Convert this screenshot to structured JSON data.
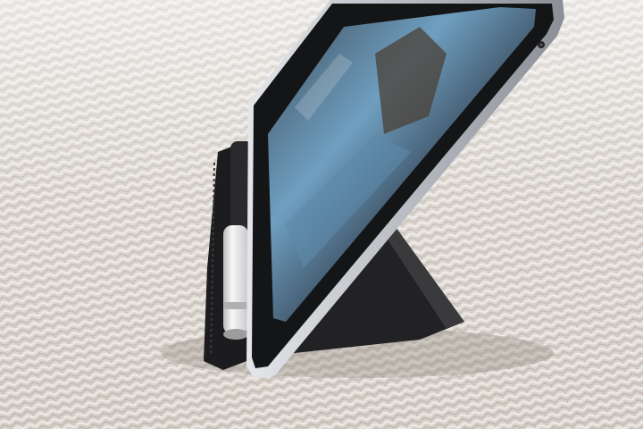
{
  "scene": {
    "subject": "tablet",
    "accessories": [
      "stylus-pencil",
      "folio-case"
    ],
    "surface": "woven-carpet"
  },
  "colors": {
    "carpet_base": "#d9d4cf",
    "carpet_light": "#ece9e5",
    "carpet_shadow": "#b8b1aa",
    "case_black": "#1c1c1e",
    "case_edge": "#3a3a3d",
    "tablet_frame": "#b9bcc2",
    "tablet_frame_dark": "#8a8e95",
    "bezel": "#141517",
    "screen_sky": "#6f9fc0",
    "screen_dark": "#2a3440",
    "pencil_white": "#eeeeee"
  }
}
